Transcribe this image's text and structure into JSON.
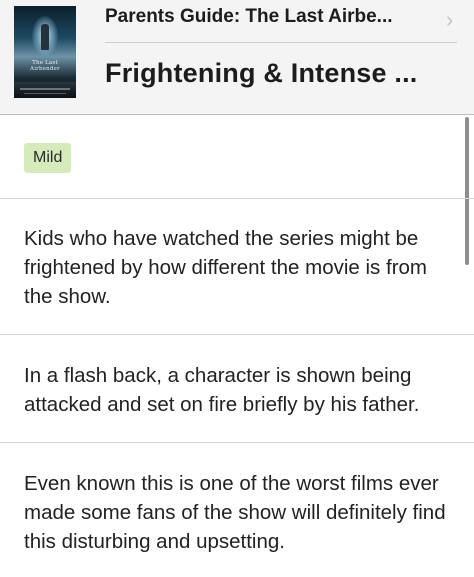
{
  "header": {
    "guide_title": "Parents Guide: The Last Airbe...",
    "section_title": "Frightening & Intense ...",
    "poster_lettering": "The Last Airbender",
    "chevron": "›"
  },
  "severity": {
    "label": "Mild",
    "color": "#d5ebbc"
  },
  "entries": [
    {
      "text": "Kids who have watched the series might be frightened by how different the movie is from the show."
    },
    {
      "text": "In a flash back, a character is shown being attacked and set on fire briefly by his father."
    },
    {
      "text": "Even known this is one of the worst films ever made some fans of the show will definitely find this disturbing and upsetting."
    }
  ]
}
